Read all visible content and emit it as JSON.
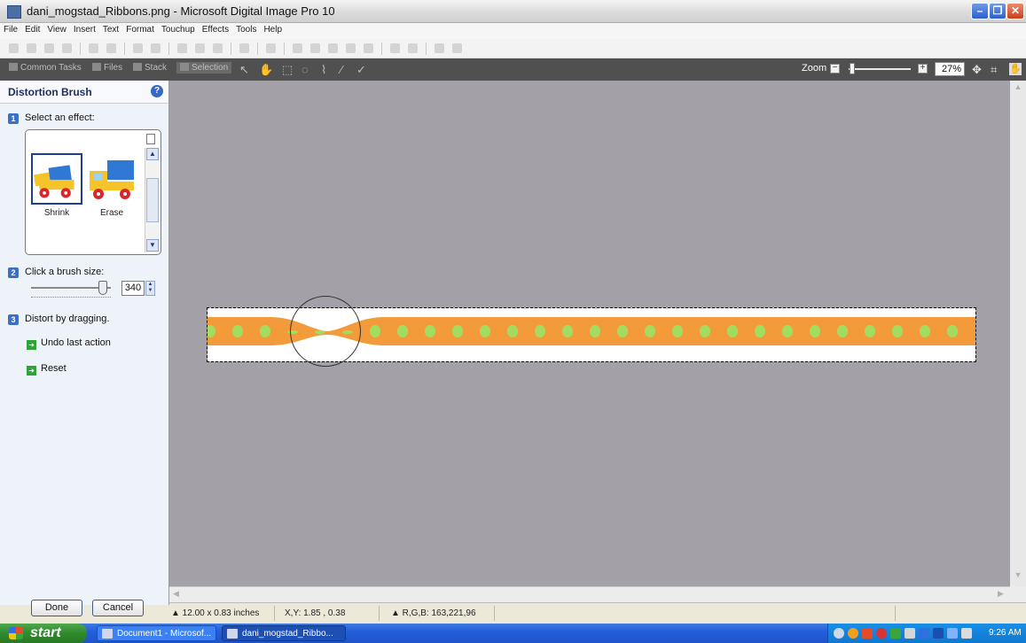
{
  "window": {
    "title": "dani_mogstad_Ribbons.png - Microsoft Digital Image Pro 10"
  },
  "menu": [
    "File",
    "Edit",
    "View",
    "Insert",
    "Text",
    "Format",
    "Touchup",
    "Effects",
    "Tools",
    "Help"
  ],
  "tasks": {
    "common": "Common Tasks",
    "files": "Files",
    "stack": "Stack",
    "selection": "Selection"
  },
  "zoom": {
    "label": "Zoom",
    "value": "27%",
    "level_percent": 27
  },
  "panel": {
    "title": "Distortion Brush",
    "help_icon": "?",
    "step1": {
      "num": "1",
      "text": "Select an effect:"
    },
    "effects": [
      {
        "label": "Shrink",
        "selected": true
      },
      {
        "label": "Erase",
        "selected": false
      }
    ],
    "step2": {
      "num": "2",
      "text": "Click a brush size:",
      "value": "340"
    },
    "step3": {
      "num": "3",
      "text": "Distort by dragging."
    },
    "undo": "Undo last action",
    "reset": "Reset",
    "done": "Done",
    "cancel": "Cancel"
  },
  "status": {
    "size": "▲ 12.00 x 0.83 inches",
    "xy": "X,Y: 1.85 , 0.38",
    "rgb": "▲ R,G,B: 163,221,96"
  },
  "taskbar": {
    "start": "start",
    "task1": "Document1 - Microsof...",
    "task2": "dani_mogstad_Ribbo...",
    "clock": "9:26 AM"
  },
  "colors": {
    "ribbon": "#F39B3A",
    "dots": "#A3DD60",
    "canvas": "#A3A1A7",
    "accent": "#3B6FC7"
  }
}
